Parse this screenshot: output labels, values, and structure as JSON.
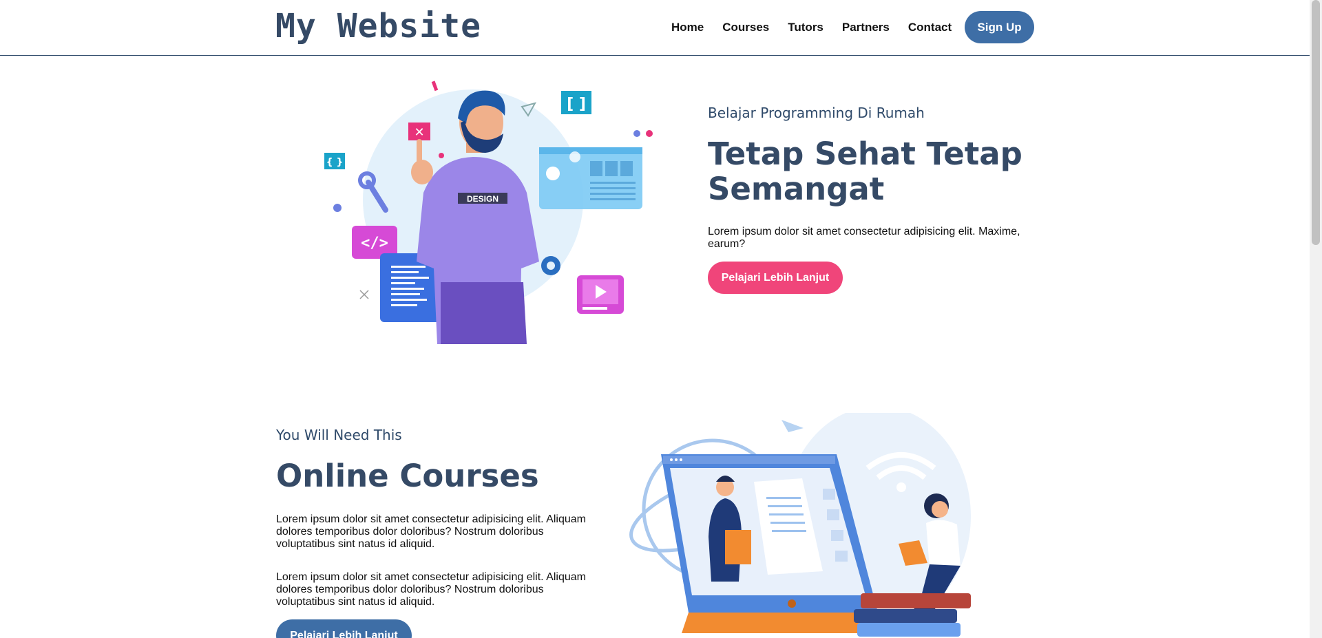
{
  "header": {
    "brand": "My Website",
    "nav": [
      "Home",
      "Courses",
      "Tutors",
      "Partners",
      "Contact"
    ],
    "signup_label": "Sign Up"
  },
  "hero": {
    "subtitle": "Belajar Programming Di Rumah",
    "title": "Tetap Sehat Tetap Semangat",
    "description": "Lorem ipsum dolor sit amet consectetur adipisicing elit. Maxime, earum?",
    "button_label": "Pelajari Lebih Lanjut",
    "illustration_badge": "DESIGN"
  },
  "courses": {
    "subtitle": "You Will Need This",
    "title": "Online Courses",
    "paragraphs": [
      "Lorem ipsum dolor sit amet consectetur adipisicing elit. Aliquam dolores temporibus dolor doloribus? Nostrum doloribus voluptatibus sint natus id aliquid.",
      "Lorem ipsum dolor sit amet consectetur adipisicing elit. Aliquam dolores temporibus dolor doloribus? Nostrum doloribus voluptatibus sint natus id aliquid."
    ],
    "button_label": "Pelajari Lebih Lanjut"
  },
  "colors": {
    "brand_navy": "#354a66",
    "button_blue": "#3e6ea6",
    "button_pink": "#f0457a"
  }
}
